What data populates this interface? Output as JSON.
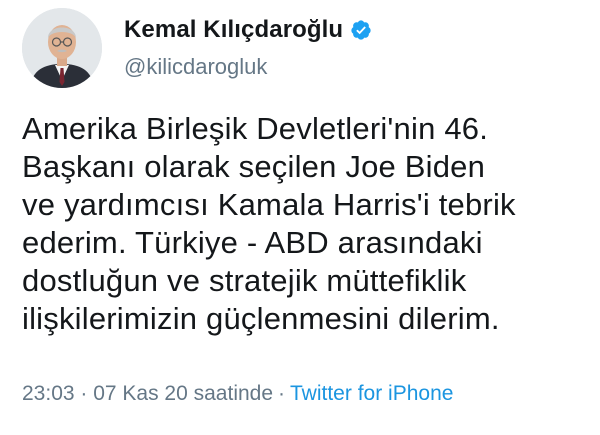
{
  "tweet": {
    "author": {
      "display_name": "Kemal Kılıçdaroğlu",
      "handle": "@kilicdarogluk",
      "verified": true,
      "avatar_icon": "profile-photo-avatar"
    },
    "text_lines": [
      "Amerika Birleşik Devletleri'nin 46.",
      "Başkanı olarak seçilen Joe Biden",
      "ve yardımcısı Kamala Harris'i tebrik",
      "ederim. Türkiye - ABD arasındaki",
      "dostluğun ve stratejik müttefiklik",
      "ilişkilerimizin güçlenmesini dilerim."
    ],
    "timestamp": "23:03 · 07 Kas 20 saatinde",
    "separator": "·",
    "source": "Twitter for iPhone"
  },
  "colors": {
    "text": "#14171a",
    "secondary": "#657786",
    "link": "#1b95e0",
    "verified_badge": "#1da1f2",
    "background": "#ffffff"
  }
}
